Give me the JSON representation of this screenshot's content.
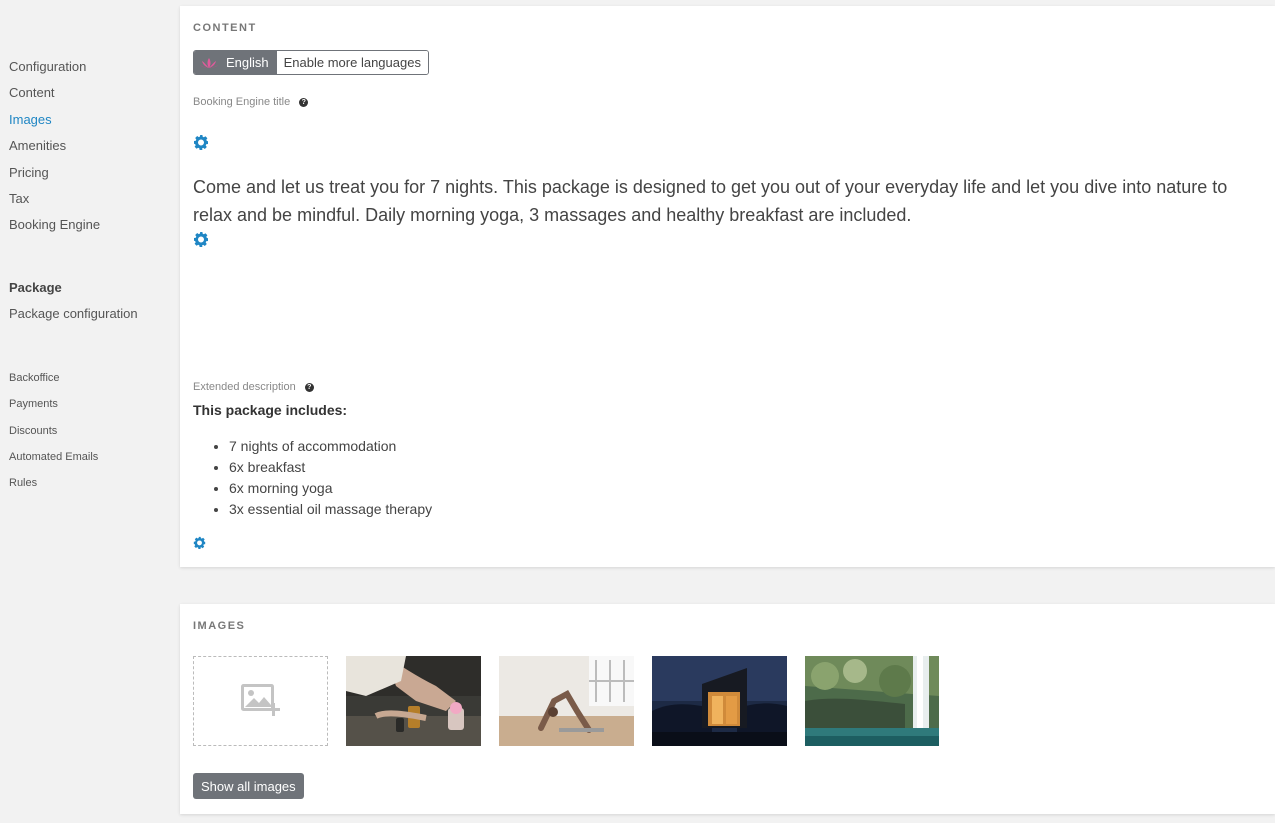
{
  "sidebar": {
    "group1": [
      "Configuration",
      "Content",
      "Images",
      "Amenities",
      "Pricing",
      "Tax",
      "Booking Engine"
    ],
    "active_item": "Images",
    "package_heading": "Package",
    "package_items": [
      "Package configuration"
    ],
    "group3": [
      "Backoffice",
      "Payments",
      "Discounts",
      "Automated Emails",
      "Rules"
    ]
  },
  "content": {
    "section_title": "CONTENT",
    "language_active": "English",
    "language_more": "Enable more languages",
    "title_label": "Booking Engine title",
    "description": "Come and let us treat you for 7 nights. This package is designed to get you out of your everyday life and let you dive into nature to relax and be mindful. Daily morning yoga, 3 massages and healthy breakfast are included.",
    "extended_label": "Extended description",
    "extended_title": "This package includes:",
    "extended_items": [
      "7 nights of accommodation",
      "6x breakfast",
      "6x morning yoga",
      "3x essential oil massage therapy"
    ]
  },
  "images": {
    "section_title": "IMAGES",
    "show_all_label": "Show all images"
  },
  "colors": {
    "accent": "#1f86c4",
    "button_grey": "#6f7379",
    "background": "#f2f2f2"
  }
}
